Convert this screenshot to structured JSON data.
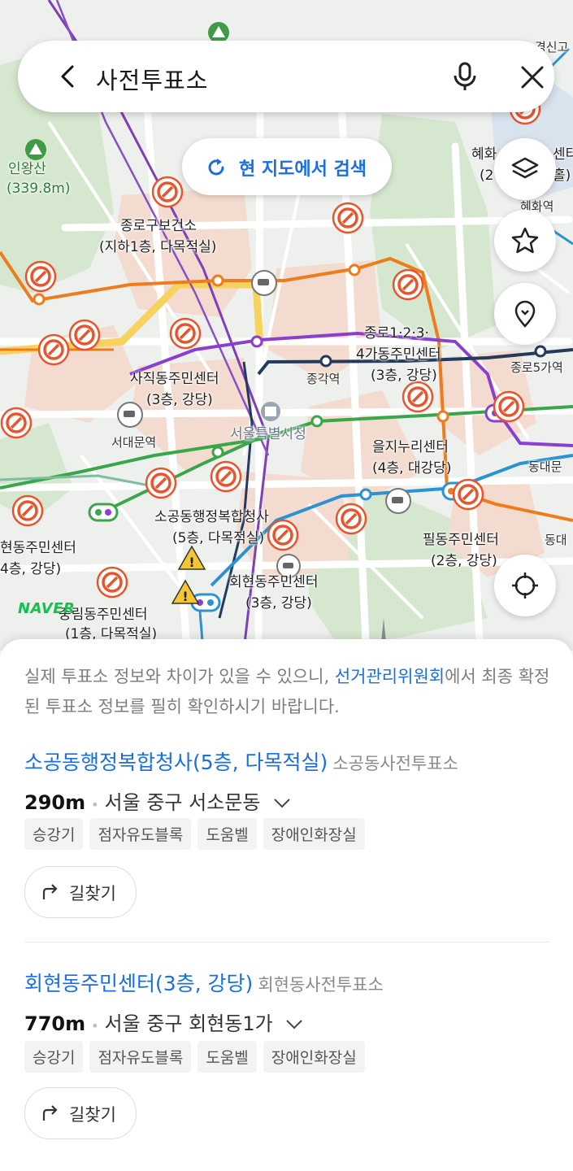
{
  "search": {
    "query": "사전투표소"
  },
  "map": {
    "research_button": "현 지도에서 검색",
    "logo": "NAVER",
    "labels": {
      "inwangsan": "인왕산",
      "inwangsan_elev": "(339.8m)",
      "jongno_health_1": "종로구보건소",
      "jongno_health_2": "(지하1층, 다목적실)",
      "jongno1234_1": "종로1·2·3·",
      "jongno1234_2": "4가동주민센터",
      "jongno1234_3": "(3층, 강당)",
      "jonggak": "종각역",
      "jongno5": "종로5가역",
      "sajik_1": "사직동주민센터",
      "sajik_2": "(3층, 강당)",
      "seodaemun": "서대문역",
      "cityhall": "서울특별시청",
      "euljinuri_1": "을지누리센터",
      "euljinuri_2": "(4층, 대강당)",
      "dongdae1": "동대문",
      "dongdae2": "동대",
      "sogong_1": "소공동행정복합청사",
      "sogong_2": "(5층, 다목적실)",
      "pildong_1": "필동주민센터",
      "pildong_2": "(2층, 강당)",
      "hoehyeon_1": "회현동주민센터",
      "hoehyeon_2": "(3층, 강당)",
      "left_center_1": "현동주민센터",
      "left_center_2": "4층, 강당)",
      "bottom_left_1": "중림동주민센터",
      "bottom_left_2": "(1층, 다목적실)",
      "hyehwa_1": "혜화",
      "hyehwa_2": "센터",
      "hyehwa_3": "(2",
      "hyehwa_4": "홀)",
      "hyehwa_station": "혜화역",
      "gyeongsin": "경신고"
    }
  },
  "sheet": {
    "notice_before": "실제 투표소 정보와 차이가 있을 수 있으니, ",
    "notice_link": "선거관리위원회",
    "notice_after": "에서 최종 확정된 투표소 정보를 필히 확인하시기 바랍니다.",
    "results": [
      {
        "name": "소공동행정복합청사(5층, 다목적실)",
        "category": "소공동사전투표소",
        "distance": "290m",
        "address": "서울 중구 서소문동",
        "tags": [
          "승강기",
          "점자유도블록",
          "도움벨",
          "장애인화장실"
        ],
        "route_label": "길찾기"
      },
      {
        "name": "회현동주민센터(3층, 강당)",
        "category": "회현동사전투표소",
        "distance": "770m",
        "address": "서울 중구 회현동1가",
        "tags": [
          "승강기",
          "점자유도블록",
          "도움벨",
          "장애인화장실"
        ],
        "route_label": "길찾기"
      }
    ]
  },
  "colors": {
    "accent_blue": "#1b6ee0",
    "pin_red": "#e8552d",
    "naver_green": "#14c14f"
  }
}
